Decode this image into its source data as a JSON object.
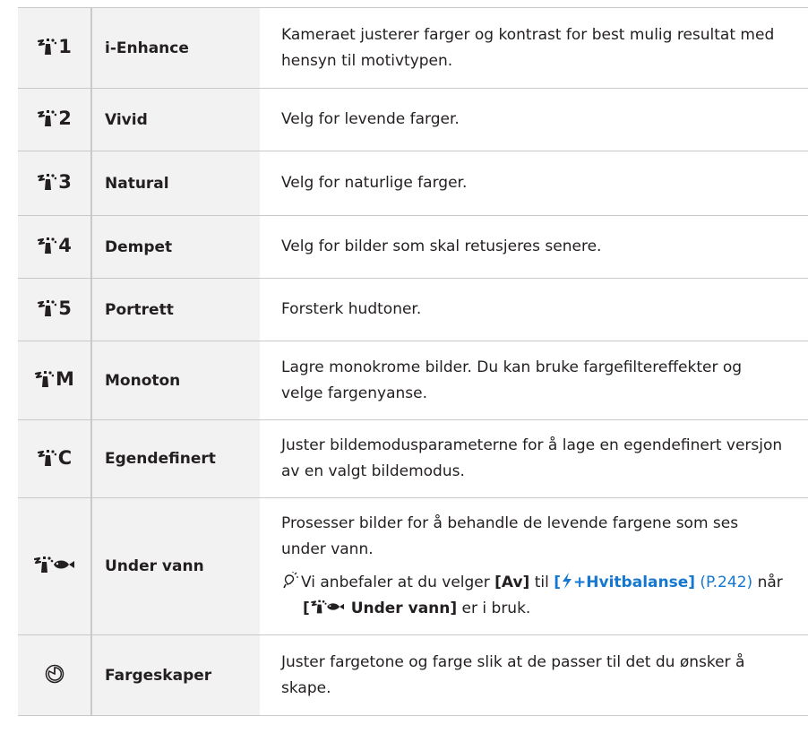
{
  "rows": [
    {
      "num": "1",
      "name": "i-Enhance",
      "desc": "Kameraet justerer farger og kontrast for best mulig resultat med hensyn til motivtypen."
    },
    {
      "num": "2",
      "name": "Vivid",
      "desc": "Velg for levende farger."
    },
    {
      "num": "3",
      "name": "Natural",
      "desc": "Velg for naturlige farger."
    },
    {
      "num": "4",
      "name": "Dempet",
      "desc": "Velg for bilder som skal retusjeres senere."
    },
    {
      "num": "5",
      "name": "Portrett",
      "desc": "Forsterk hudtoner."
    },
    {
      "num": "M",
      "name": "Monoton",
      "desc": "Lagre monokrome bilder. Du kan bruke fargefiltereffekter og velge fargenyanse."
    },
    {
      "num": "C",
      "name": "Egendefinert",
      "desc": "Juster bildemodusparameterne for å lage en egendefinert versjon av en valgt bildemodus."
    }
  ],
  "underwater": {
    "name": "Under vann",
    "desc": "Prosesser bilder for å behandle de levende fargene som ses under vann.",
    "note_a": "Vi anbefaler at du velger",
    "note_av": "[Av]",
    "note_b": "til",
    "note_link_open": "[",
    "note_link_text": "+Hvitbalanse]",
    "note_page": "(P.242)",
    "note_c": "når",
    "note_bold_open": "[",
    "note_bold_text": "Under vann]",
    "note_d": "er i bruk."
  },
  "color_creator": {
    "name": "Fargeskaper",
    "desc": "Juster fargetone og farge slik at de passer til det du ønsker å skape."
  },
  "colors": {
    "link": "#1477d0",
    "label_bg": "#f2f2f2",
    "rule": "#c9c9c9"
  },
  "icons": [
    "picture-mode-icon",
    "underwater-fish-icon",
    "color-creator-icon",
    "hint-icon",
    "flash-icon"
  ]
}
